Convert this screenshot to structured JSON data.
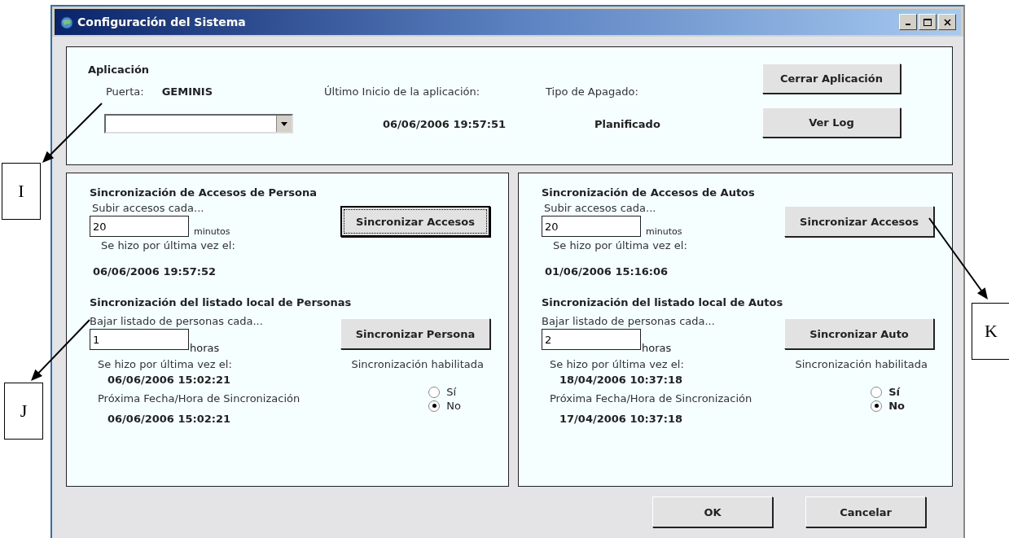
{
  "window": {
    "title": "Configuración del Sistema"
  },
  "application": {
    "heading": "Aplicación",
    "door_label": "Puerta:",
    "door_value": "GEMINIS",
    "last_start_label": "Último Inicio de la aplicación:",
    "last_start_value": "06/06/2006 19:57:51",
    "shutdown_label": "Tipo de Apagado:",
    "shutdown_value": "Planificado",
    "buttons": [
      "Cerrar Aplicación",
      "Ver Log"
    ]
  },
  "panels": [
    {
      "access_heading": "Sincronización de Accesos de Persona",
      "upload_label": "Subir accesos cada...",
      "upload_value": "20",
      "upload_unit": "minutos",
      "sync_button": "Sincronizar Accesos",
      "focused": true,
      "last_label": "Se hizo por última vez el:",
      "last_value": "06/06/2006 19:57:52",
      "list_heading": "Sincronización del listado local de Personas",
      "download_label": "Bajar listado de personas cada...",
      "download_value": "1",
      "download_unit": "horas",
      "list_button": "Sincronizar Persona",
      "list_last_label": "Se hizo por última vez el:",
      "list_last_value": "06/06/2006 15:02:21",
      "enabled_label": "Sincronización habilitada",
      "next_label": "Próxima Fecha/Hora de Sincronización",
      "next_value": "06/06/2006 15:02:21",
      "options": [
        {
          "label": "Sí",
          "selected": false
        },
        {
          "label": "No",
          "selected": true
        }
      ]
    },
    {
      "access_heading": "Sincronización de Accesos de Autos",
      "upload_label": "Subir accesos cada...",
      "upload_value": "20",
      "upload_unit": "minutos",
      "sync_button": "Sincronizar Accesos",
      "focused": false,
      "last_label": "Se hizo por última vez el:",
      "last_value": "01/06/2006 15:16:06",
      "list_heading": "Sincronización del listado local de Autos",
      "download_label": "Bajar listado de personas cada...",
      "download_value": "2",
      "download_unit": "horas",
      "list_button": "Sincronizar Auto",
      "list_last_label": "Se hizo por última vez el:",
      "list_last_value": "18/04/2006 10:37:18",
      "enabled_label": "Sincronización habilitada",
      "next_label": "Próxima Fecha/Hora de Sincronización",
      "next_value": "17/04/2006 10:37:18",
      "options": [
        {
          "label": "Sí",
          "selected": false
        },
        {
          "label": "No",
          "selected": true
        }
      ]
    }
  ],
  "buttons": [
    "OK",
    "Cancelar"
  ],
  "callouts": [
    {
      "label": "I"
    },
    {
      "label": "J"
    },
    {
      "label": "K"
    }
  ]
}
